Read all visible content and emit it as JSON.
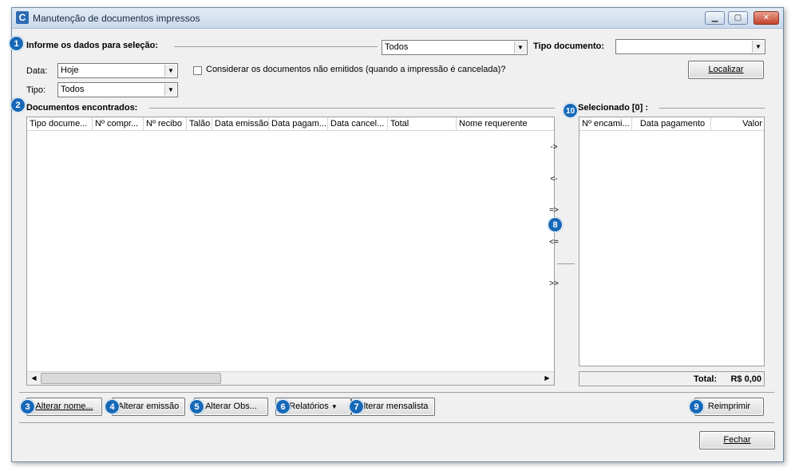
{
  "window": {
    "title": "Manutenção de documentos impressos",
    "icon_letter": "C",
    "controls": {
      "minimize": "▁",
      "restore": "▢",
      "close": "✕"
    }
  },
  "selection": {
    "section_label": "Informe os dados para seleção:",
    "status_value": "Todos",
    "tipo_documento_label": "Tipo documento:",
    "tipo_documento_value": "",
    "data_label": "Data:",
    "data_value": "Hoje",
    "tipo_label": "Tipo:",
    "tipo_value": "Todos",
    "checkbox_label": "Considerar os documentos não emitidos (quando a impressão é cancelada)?",
    "localizar_label": "Localizar"
  },
  "found": {
    "section_label": "Documentos encontrados:",
    "columns": [
      "Tipo docume...",
      "Nº compr...",
      "Nº recibo",
      "Talão",
      "Data emissão",
      "Data pagam...",
      "Data cancel...",
      "Total",
      "Nome requerente"
    ]
  },
  "selected": {
    "section_label": "Selecionado [0] :",
    "columns": [
      "Nº encami...",
      "Data pagamento",
      "Valor"
    ],
    "total_label": "Total:",
    "total_value": "R$ 0,00"
  },
  "move_buttons": [
    "->",
    "<-",
    "=>",
    "<=",
    ">>"
  ],
  "actions": {
    "alterar_nome": "Alterar nome...",
    "alterar_emissao": "Alterar emissão",
    "alterar_obs": "Alterar Obs...",
    "relatorios": "Relatórios",
    "alterar_mensalista": "Alterar mensalista",
    "reimprimir": "Reimprimir",
    "fechar": "Fechar"
  },
  "badges": [
    "1",
    "2",
    "3",
    "4",
    "5",
    "6",
    "7",
    "8",
    "9",
    "10"
  ],
  "colors": {
    "badge": "#1769b8",
    "window_bg": "#f0f0f0",
    "title_gradient": "#c9d9ec"
  }
}
